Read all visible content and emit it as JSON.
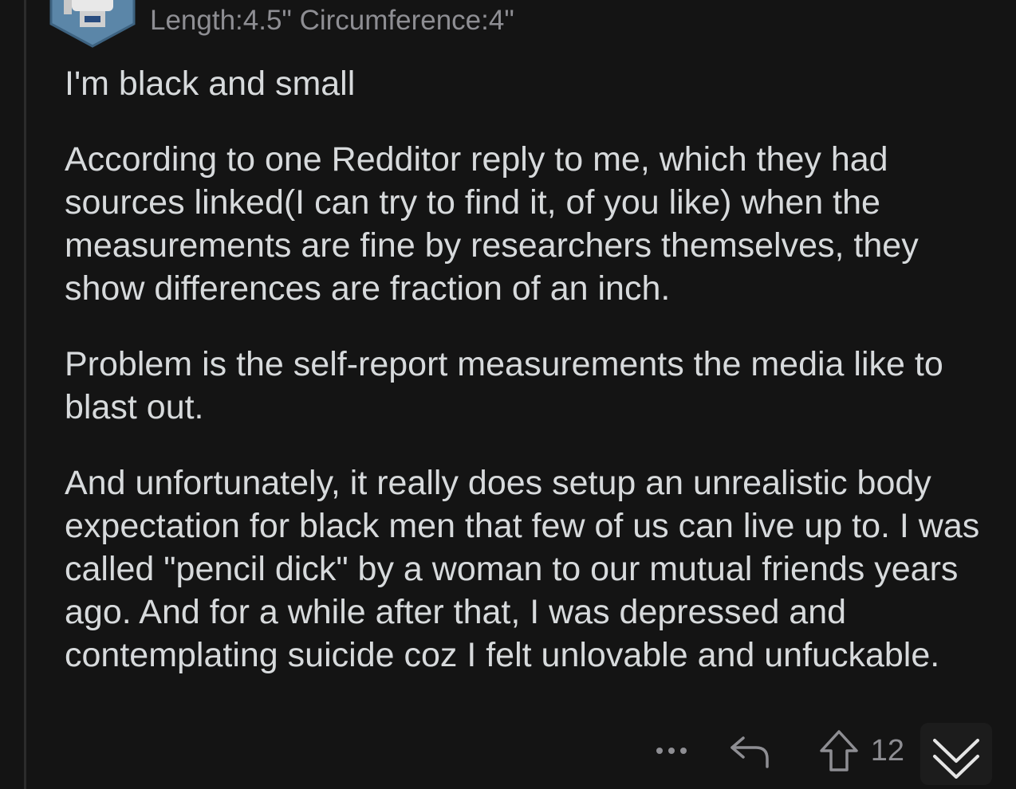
{
  "comment": {
    "flair": "Length:4.5\" Circumference:4\"",
    "paragraphs": [
      "I'm black and small",
      "According to one Redditor reply to me, which they had sources linked(I can try to find it, of you like) when the measurements are fine by researchers themselves, they show differences are fraction of an inch.",
      "Problem is the self-report measurements the media like to blast out.",
      "And unfortunately, it really does setup an unrealistic body expectation for black men that few of us can live up to. I was called \"pencil dick\" by a woman to our mutual friends years ago. And for a while after that, I was depressed and contemplating suicide coz I felt unlovable and unfuckable."
    ],
    "score": "12"
  },
  "icons": {
    "more": "more-horizontal-icon",
    "reply": "reply-arrow-icon",
    "upvote": "upvote-arrow-icon",
    "collapse": "chevron-down-icon",
    "avatar": "robot-avatar-icon"
  },
  "colors": {
    "background": "#141414",
    "text": "#d7dadc",
    "muted": "#8e8e93"
  }
}
